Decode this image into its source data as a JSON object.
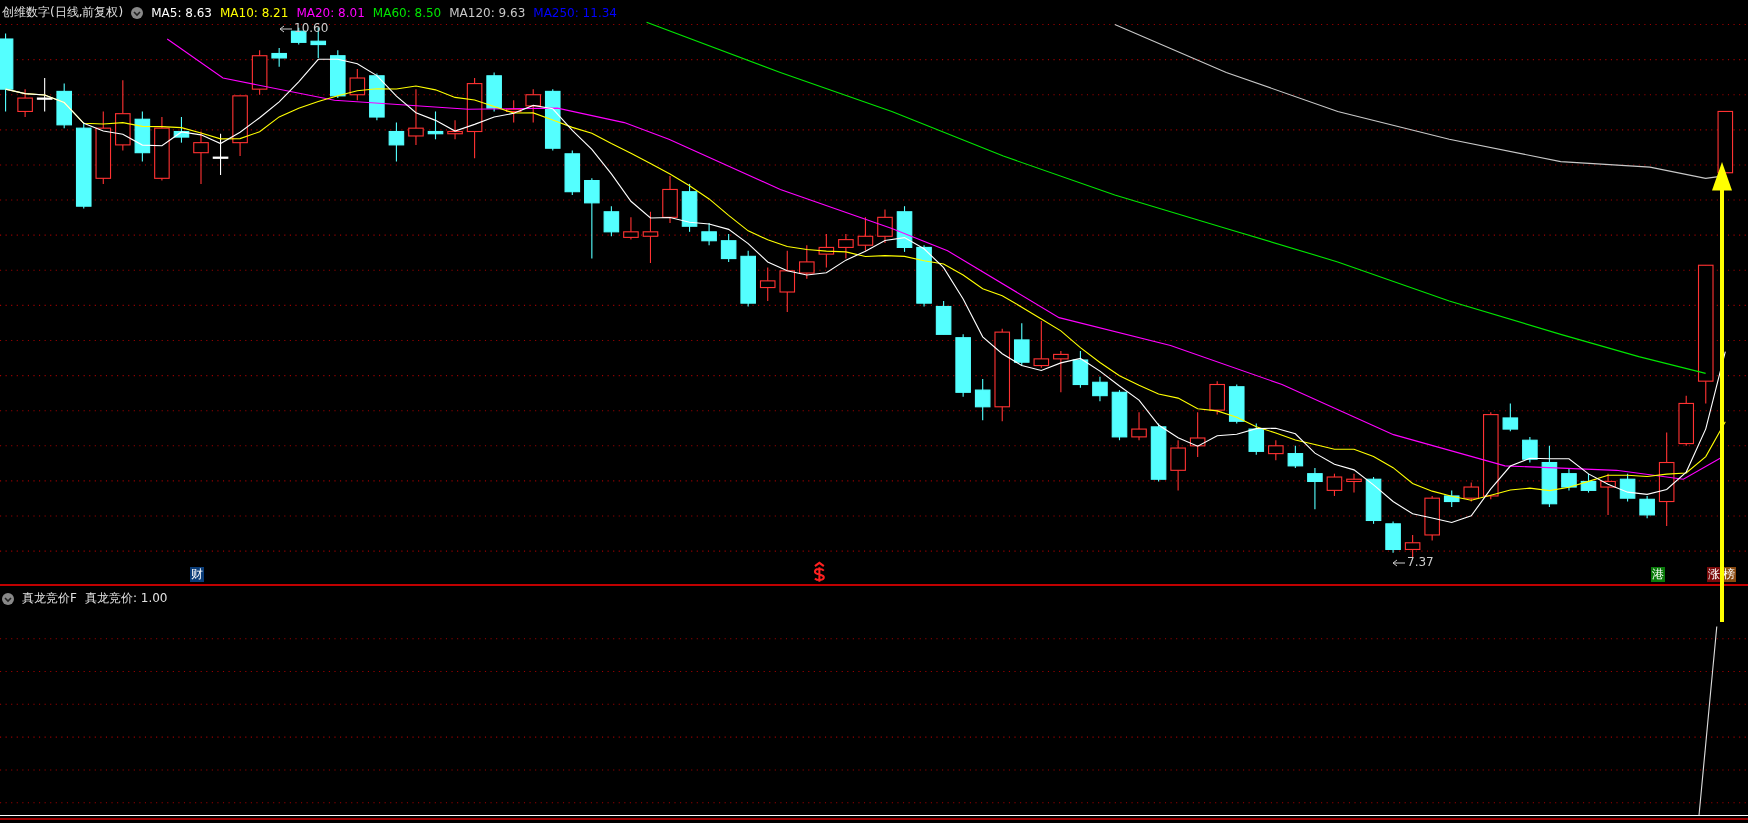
{
  "main_chart": {
    "title": "创维数字(日线,前复权)",
    "indicators": [
      {
        "label": "MA5: 8.63",
        "color": "#ffffff"
      },
      {
        "label": "MA10: 8.21",
        "color": "#ffff00"
      },
      {
        "label": "MA20: 8.01",
        "color": "#ff00ff"
      },
      {
        "label": "MA60: 8.50",
        "color": "#00e600"
      },
      {
        "label": "MA120: 9.63",
        "color": "#c8c8c8"
      },
      {
        "label": "MA250: 11.34",
        "color": "#0000ff"
      }
    ],
    "high_label": "10.60",
    "low_label": "7.37",
    "markers": [
      {
        "text": "财",
        "color": "#0a3c78"
      },
      {
        "text": "港",
        "color": "#0a7a0a"
      },
      {
        "text": "涨",
        "color": "#7a0a0a"
      },
      {
        "text": "榜",
        "color": "#8a4a10"
      }
    ]
  },
  "sub_chart": {
    "title": "真龙竞价F",
    "reading": "真龙竞价: 1.00"
  }
}
